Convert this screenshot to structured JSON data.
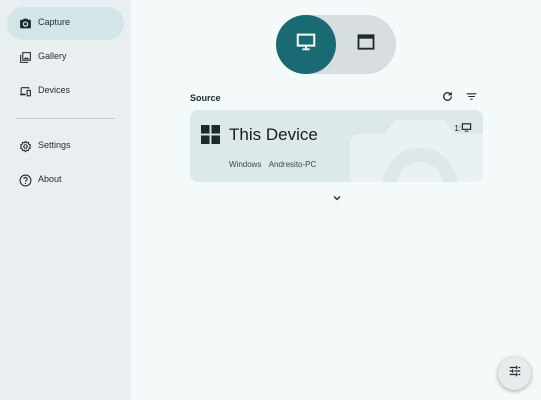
{
  "sidebar": {
    "items": [
      {
        "label": "Capture",
        "icon": "camera-icon",
        "active": true
      },
      {
        "label": "Gallery",
        "icon": "gallery-icon",
        "active": false
      },
      {
        "label": "Devices",
        "icon": "devices-icon",
        "active": false
      },
      {
        "label": "Settings",
        "icon": "gear-icon",
        "active": false
      },
      {
        "label": "About",
        "icon": "help-icon",
        "active": false
      }
    ]
  },
  "mode_toggle": {
    "options": [
      {
        "icon": "monitor-icon",
        "selected": true
      },
      {
        "icon": "window-icon",
        "selected": false
      }
    ]
  },
  "source": {
    "title": "Source",
    "card": {
      "name": "This Device",
      "os": "Windows",
      "hostname": "Andresito-PC",
      "badge": "1:"
    }
  },
  "colors": {
    "accent": "#1a6a74",
    "sidebar_bg": "#e9eef0",
    "active_item_bg": "#d2e6ea",
    "card_bg": "#dce8e9",
    "page_bg": "#f4f9fa"
  }
}
